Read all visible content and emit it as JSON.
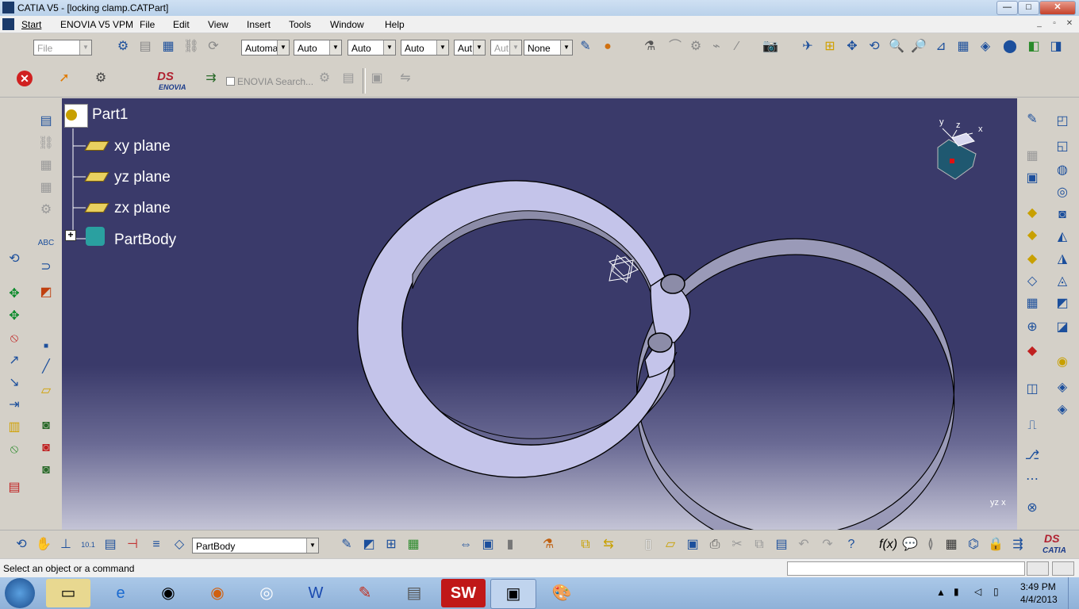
{
  "window": {
    "title": "CATIA V5 - [locking clamp.CATPart]",
    "min_label": "—",
    "max_label": "□",
    "close_label": "✕"
  },
  "menu": {
    "items": [
      "Start",
      "ENOVIA V5 VPM",
      "File",
      "Edit",
      "View",
      "Insert",
      "Tools",
      "Window",
      "Help"
    ]
  },
  "toolbar": {
    "file_combo": "File",
    "combo1": "Automa",
    "combo2": "Auto",
    "combo3": "Auto",
    "combo4": "Auto",
    "combo5": "Aut",
    "combo6": "Aut",
    "combo7": "None",
    "enovia_search": "ENOVIA Search...",
    "enovia_logo": "ENOVIA"
  },
  "tree": {
    "root": "Part1",
    "items": [
      "xy plane",
      "yz plane",
      "zx plane",
      "PartBody"
    ]
  },
  "compass": {
    "x": "x",
    "y": "y",
    "z": "z"
  },
  "bottom_toolbar": {
    "body_combo": "PartBody",
    "catia_logo": "CATIA"
  },
  "statusbar": {
    "message": "Select an object or a command"
  },
  "taskbar": {
    "time": "3:49 PM",
    "date": "4/4/2013"
  },
  "colors": {
    "viewport_top": "#3a3a6a",
    "part_face": "#c4c4ea",
    "part_side": "#9a9ab8"
  }
}
